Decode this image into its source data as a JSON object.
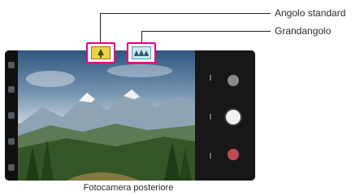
{
  "callouts": {
    "standard_label": "Angolo standard",
    "wide_label": "Grandangolo"
  },
  "caption": "Fotocamera posteriore",
  "camera": {
    "lens_buttons": [
      {
        "name": "standard-angle-button",
        "icon": "tree-icon",
        "state": "selected"
      },
      {
        "name": "wide-angle-button",
        "icon": "trees-icon",
        "state": "unselected"
      }
    ],
    "left_bar_icons": [
      "flash-icon",
      "timer-icon",
      "settings-icon",
      "mode-icon",
      "switch-camera-icon"
    ],
    "right_panel": {
      "buttons": [
        "gallery-thumbnail",
        "shutter-button",
        "record-button"
      ]
    }
  },
  "colors": {
    "highlight": "#e6007e",
    "shutter": "#f0f0f0",
    "record": "#c24a52"
  }
}
